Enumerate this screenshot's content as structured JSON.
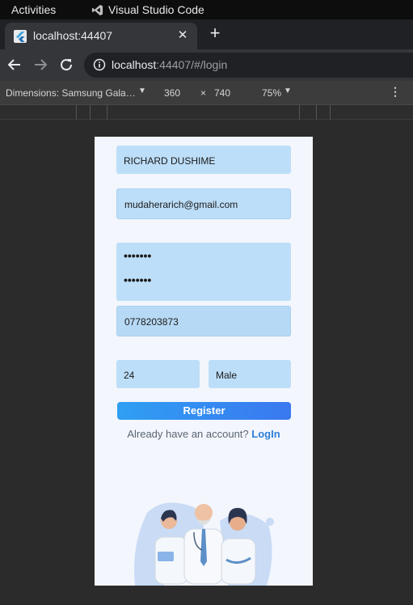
{
  "os": {
    "activities": "Activities",
    "app_name": "Visual Studio Code"
  },
  "browser": {
    "tab_title": "localhost:44407",
    "url_host": "localhost",
    "url_rest": ":44407/#/login"
  },
  "device_toolbar": {
    "dimensions": "Dimensions: Samsung Gala…",
    "width": "360",
    "times": "×",
    "height": "740",
    "zoom": "75%"
  },
  "form": {
    "name": "RICHARD DUSHIME",
    "email": "mudaherarich@gmail.com",
    "password": "•••••••",
    "confirm_password": "•••••••",
    "phone": "0778203873",
    "age": "24",
    "gender": "Male",
    "register_label": "Register",
    "login_prompt": "Already have an account?",
    "login_link": "LogIn"
  }
}
